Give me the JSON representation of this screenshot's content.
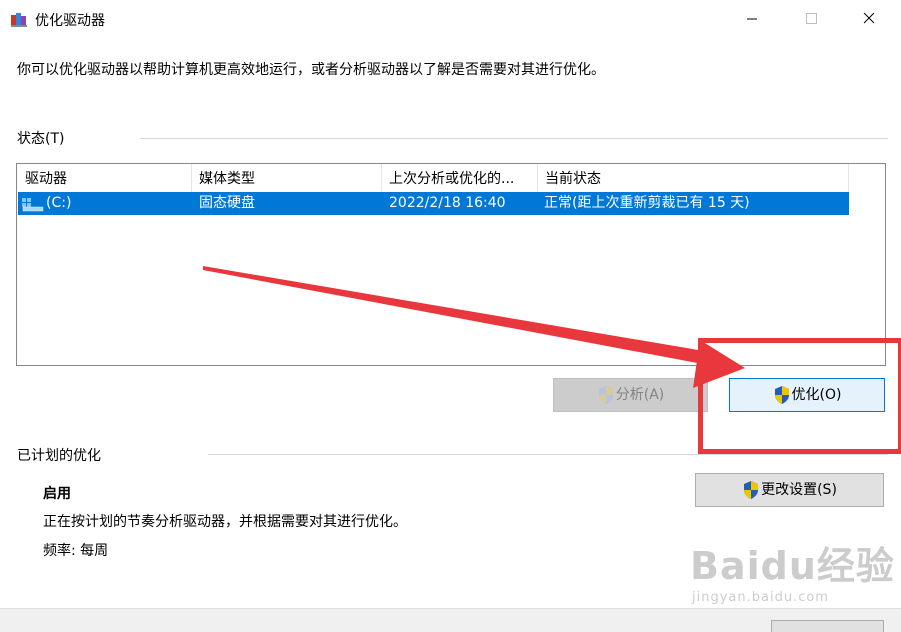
{
  "window": {
    "title": "优化驱动器",
    "controls": {
      "minimize": "minimize-icon",
      "maximize": "maximize-icon",
      "close": "close-icon"
    }
  },
  "intro_text": "你可以优化驱动器以帮助计算机更高效地运行，或者分析驱动器以了解是否需要对其进行优化。",
  "status_section": {
    "label": "状态(T)",
    "columns": [
      "驱动器",
      "媒体类型",
      "上次分析或优化的...",
      "当前状态"
    ],
    "rows": [
      {
        "drive": "(C:)",
        "media_type": "固态硬盘",
        "last_run": "2022/2/18 16:40",
        "status": "正常(距上次重新剪裁已有 15 天)",
        "selected": true
      }
    ]
  },
  "buttons": {
    "analyze": "分析(A)",
    "optimize": "优化(O)",
    "change_settings": "更改设置(S)"
  },
  "scheduled": {
    "label": "已计划的优化",
    "state": "启用",
    "description": "正在按计划的节奏分析驱动器，并根据需要对其进行优化。",
    "frequency": "频率: 每周"
  },
  "watermark": {
    "logo": "Baidu经验",
    "url": "jingyan.baidu.com"
  },
  "colors": {
    "selection": "#0078d7",
    "annotation": "#e8383d",
    "shield_blue": "#1f5fb7",
    "shield_yellow": "#f2c300"
  }
}
